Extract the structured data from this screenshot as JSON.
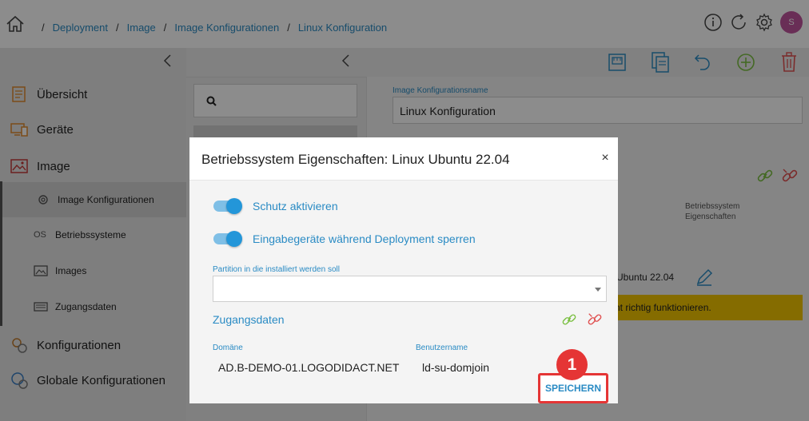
{
  "breadcrumb": {
    "items": [
      "Deployment",
      "Image",
      "Image Konfigurationen",
      "Linux Konfiguration"
    ]
  },
  "header": {
    "avatar_initial": "S",
    "avatar_color": "#c0559d"
  },
  "sidebar": {
    "items": [
      {
        "label": "Übersicht",
        "icon": "overview-icon"
      },
      {
        "label": "Geräte",
        "icon": "devices-icon"
      },
      {
        "label": "Image",
        "icon": "image-icon"
      },
      {
        "label": "Konfigurationen",
        "icon": "gears-icon"
      },
      {
        "label": "Globale Konfigurationen",
        "icon": "global-gears-icon"
      }
    ],
    "sub_items": [
      {
        "label": "Image Konfigurationen",
        "icon": "gears-icon",
        "active": true
      },
      {
        "label": "Betriebssysteme",
        "icon_text": "OS"
      },
      {
        "label": "Images",
        "icon": "image-icon"
      },
      {
        "label": "Zugangsdaten",
        "icon": "credentials-icon"
      }
    ]
  },
  "content": {
    "config_name_label": "Image Konfigurationsname",
    "config_name_value": "Linux Konfiguration",
    "column_header_line1": "Betriebssystem",
    "column_header_line2": "Eigenschaften",
    "os_value_fragment": "Ubuntu 22.04",
    "warning_fragment": "nt richtig funktionieren."
  },
  "modal": {
    "title": "Betriebssystem Eigenschaften: Linux Ubuntu 22.04",
    "close_glyph": "×",
    "toggles": [
      {
        "label": "Schutz aktivieren",
        "on": true
      },
      {
        "label": "Eingabegeräte während Deployment sperren",
        "on": true
      }
    ],
    "partition_label": "Partition in die installiert werden soll",
    "partition_value": "",
    "credentials_title": "Zugangsdaten",
    "domain_label": "Domäne",
    "domain_value": "AD.B-DEMO-01.LOGODIDACT.NET",
    "username_label": "Benutzername",
    "username_value": "ld-su-domjoin",
    "save_label": "SPEICHERN",
    "step_badge": "1"
  },
  "colors": {
    "accent": "#2a8bc4",
    "toggle": "#2396d9",
    "highlight": "#e53535",
    "warning": "#f2c500",
    "link_green": "#7cc043",
    "link_red": "#e05050"
  }
}
